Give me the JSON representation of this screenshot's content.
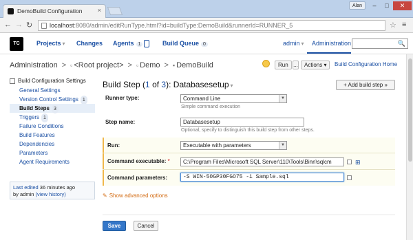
{
  "browser": {
    "tab_title": "DemoBuild Configuration",
    "tab_close": "×",
    "user_chip": "Alan",
    "win_min": "–",
    "win_max": "□",
    "win_close": "✕",
    "back": "←",
    "forward": "→",
    "reload": "↻",
    "url_host": "localhost",
    "url_rest": ":8080/admin/editRunType.html?id=buildType:DemoBuild&runnerId=RUNNER_5",
    "star": "☆",
    "menu": "≡"
  },
  "header": {
    "logo_text": "TC",
    "nav": {
      "projects": "Projects",
      "changes": "Changes",
      "agents": "Agents",
      "agents_count": "1",
      "build_queue": "Build Queue",
      "queue_count": "0"
    },
    "dropdown_glyph": "▾",
    "admin_user": "admin",
    "administration": "Administration",
    "search_placeholder": "",
    "search_icon": "🔍"
  },
  "breadcrumb": {
    "administration": "Administration",
    "sep": ">",
    "root_project": "<Root project>",
    "demo": "Demo",
    "demo_build": "DemoBuild",
    "run_label": "Run",
    "run_more": "...",
    "actions_label": "Actions ▾",
    "config_home": "Build Configuration Home"
  },
  "sidebar": {
    "title": "Build Configuration Settings",
    "items": [
      {
        "label": "General Settings",
        "badge": ""
      },
      {
        "label": "Version Control Settings",
        "badge": "1"
      },
      {
        "label": "Build Steps",
        "badge": "3"
      },
      {
        "label": "Triggers",
        "badge": "1"
      },
      {
        "label": "Failure Conditions",
        "badge": ""
      },
      {
        "label": "Build Features",
        "badge": ""
      },
      {
        "label": "Dependencies",
        "badge": ""
      },
      {
        "label": "Parameters",
        "badge": ""
      },
      {
        "label": "Agent Requirements",
        "badge": ""
      }
    ],
    "last_edited_label": "Last edited",
    "last_edited_time": "36 minutes ago",
    "by_label": "by admin",
    "view_history": "(view history)"
  },
  "main": {
    "title_prefix": "Build Step (",
    "step_num": "1",
    "of": " of ",
    "step_total": "3",
    "title_suffix": "): Databasesetup",
    "add_step": "+ Add build step »",
    "runner_type_label": "Runner type:",
    "runner_type_value": "Command Line",
    "runner_type_hint": "Simple command execution",
    "step_name_label": "Step name:",
    "step_name_value": "Databasesetup",
    "step_name_hint": "Optional, specify to distinguish this build step from other steps.",
    "run_label": "Run:",
    "run_value": "Executable with parameters",
    "cmd_exec_label": "Command executable:",
    "required_mark": "*",
    "cmd_exec_value": "C:\\Program Files\\Microsoft SQL Server\\110\\Tools\\Binn\\sqlcm",
    "cmd_params_label": "Command parameters:",
    "cmd_params_value": "-S WIN-50GP30FGO75 -i Sample.sql",
    "show_advanced": "Show advanced options",
    "wrench_glyph": "✎",
    "tree_glyph": "⊞",
    "save": "Save",
    "cancel": "Cancel"
  },
  "colors": {
    "link": "#1a4fa3",
    "save_button": "#3477c9",
    "run_panel_accent": "#f0b84a",
    "advanced_link": "#d36b12"
  }
}
